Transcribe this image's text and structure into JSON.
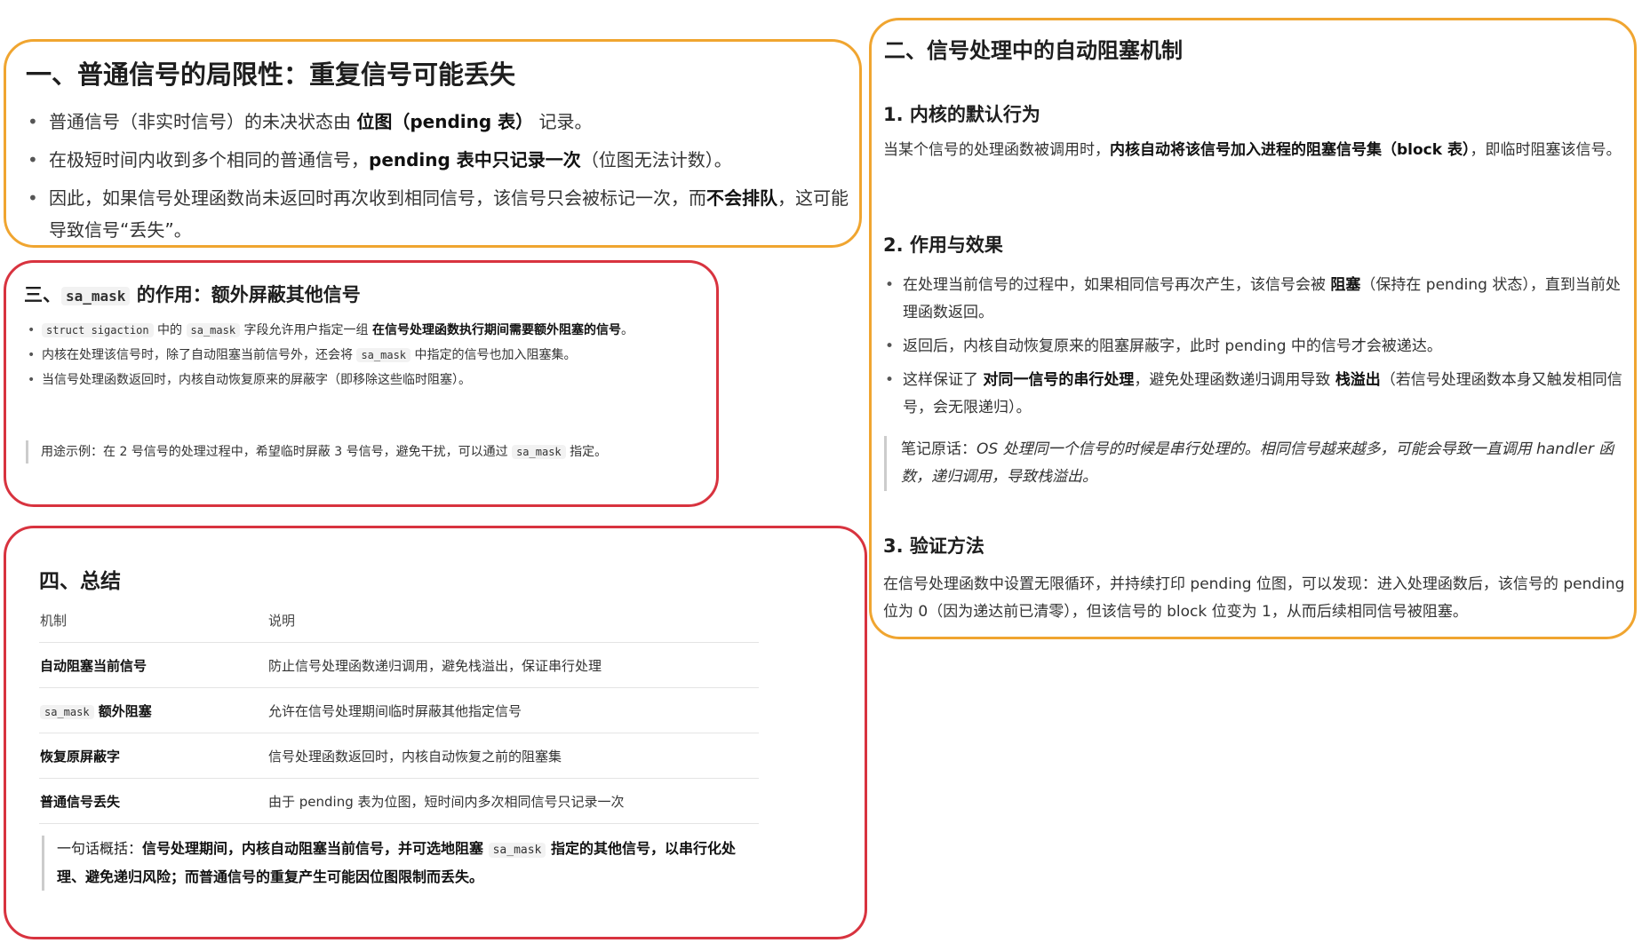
{
  "section1": {
    "title": "一、普通信号的局限性：重复信号可能丢失",
    "b1_pre": "普通信号（非实时信号）的未决状态由 ",
    "b1_bold": "位图（pending 表）",
    "b1_post": " 记录。",
    "b2_pre": "在极短时间内收到多个相同的普通信号，",
    "b2_bold": "pending 表中只记录一次",
    "b2_post": "（位图无法计数）。",
    "b3_pre": "因此，如果信号处理函数尚未返回时再次收到相同信号，该信号只会被标记一次，而",
    "b3_bold": "不会排队",
    "b3_post": "，这可能导致信号“丢失”。"
  },
  "section2": {
    "title": "二、信号处理中的自动阻塞机制",
    "h1": "1. 内核的默认行为",
    "p1_pre": "当某个信号的处理函数被调用时，",
    "p1_bold": "内核自动将该信号加入进程的阻塞信号集（block 表）",
    "p1_post": "，即临时阻塞该信号。",
    "h2": "2. 作用与效果",
    "b1_pre": "在处理当前信号的过程中，如果相同信号再次产生，该信号会被 ",
    "b1_bold": "阻塞",
    "b1_post": "（保持在 pending 状态），直到当前处理函数返回。",
    "b2": "返回后，内核自动恢复原来的阻塞屏蔽字，此时 pending 中的信号才会被递达。",
    "b3_pre": "这样保证了 ",
    "b3_bold1": "对同一信号的串行处理",
    "b3_mid": "，避免处理函数递归调用导致 ",
    "b3_bold2": "栈溢出",
    "b3_post": "（若信号处理函数本身又触发相同信号，会无限递归）。",
    "note_label": "笔记原话：",
    "note_text": "OS 处理同一个信号的时候是串行处理的。相同信号越来越多，可能会导致一直调用 handler 函数，递归调用，导致栈溢出。",
    "h3": "3. 验证方法",
    "p3": "在信号处理函数中设置无限循环，并持续打印 pending 位图，可以发现：进入处理函数后，该信号的 pending 位为 0（因为递达前已清零），但该信号的 block 位变为 1，从而后续相同信号被阻塞。"
  },
  "section3": {
    "title_pre": "三、",
    "title_code": "sa_mask",
    "title_post": " 的作用：额外屏蔽其他信号",
    "b1_code1": "struct sigaction",
    "b1_mid": " 中的 ",
    "b1_code2": "sa_mask",
    "b1_text": " 字段允许用户指定一组 ",
    "b1_bold": "在信号处理函数执行期间需要额外阻塞的信号",
    "b1_post": "。",
    "b2_pre": "内核在处理该信号时，除了自动阻塞当前信号外，还会将 ",
    "b2_code": "sa_mask",
    "b2_post": " 中指定的信号也加入阻塞集。",
    "b3": "当信号处理函数返回时，内核自动恢复原来的屏蔽字（即移除这些临时阻塞）。",
    "quote_pre": "用途示例：在 2 号信号的处理过程中，希望临时屏蔽 3 号信号，避免干扰，可以通过 ",
    "quote_code": "sa_mask",
    "quote_post": " 指定。"
  },
  "section4": {
    "title": "四、总结",
    "col1": "机制",
    "col2": "说明",
    "rows": [
      {
        "k": "自动阻塞当前信号",
        "v": "防止信号处理函数递归调用，避免栈溢出，保证串行处理"
      },
      {
        "k_code": "sa_mask",
        "k": " 额外阻塞",
        "v": "允许在信号处理期间临时屏蔽其他指定信号"
      },
      {
        "k": "恢复原屏蔽字",
        "v": "信号处理函数返回时，内核自动恢复之前的阻塞集"
      },
      {
        "k": "普通信号丢失",
        "v": "由于 pending 表为位图，短时间内多次相同信号只记录一次"
      }
    ],
    "quote_label": "一句话概括：",
    "quote_bold1": "信号处理期间，内核自动阻塞当前信号，并可选地阻塞 ",
    "quote_code": "sa_mask",
    "quote_bold2": " 指定的其他信号，以串行化处理、避免递归风险；而普通信号的重复产生可能因位图限制而丢失。"
  }
}
